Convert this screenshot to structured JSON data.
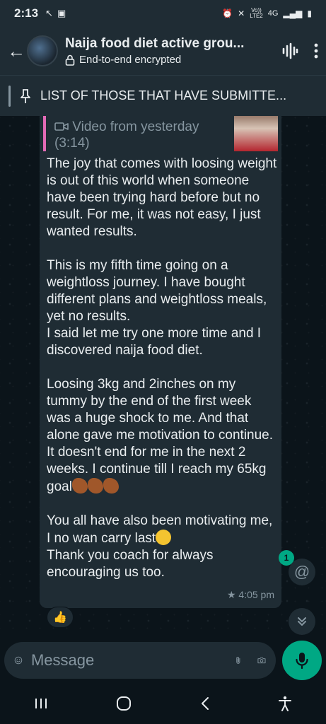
{
  "status_bar": {
    "time": "2:13",
    "net_label_top": "Vo))",
    "net_label_bottom": "LTE2",
    "signal_label": "4G"
  },
  "header": {
    "title": "Naija food diet active grou...",
    "subtitle": "End-to-end encrypted"
  },
  "pinned": {
    "text": "LIST OF THOSE THAT HAVE SUBMITTE..."
  },
  "message": {
    "quote_line1": "Video from yesterday",
    "quote_line2": "(3:14)",
    "text_part1": "The joy that comes with loosing weight is out of this world when someone have been trying hard before but no result. For me, it was not easy, I just wanted results.\n\nThis is my fifth time going on a weightloss journey. I have bought different plans and weightloss meals, yet no results.\nI said let me try one more time and I discovered naija food diet.\n\nLoosing 3kg and 2inches on my tummy by the end of the first week was a huge shock to me. And that alone gave me motivation to continue. It doesn't end for me in the next 2 weeks. I continue till I reach my 65kg goal",
    "text_part2": "\n\nYou all have also been motivating me, I no wan carry last",
    "text_part3": "\nThank you coach for always encouraging us too.",
    "time": "4:05 pm",
    "star": "★"
  },
  "reaction": {
    "emoji": "👍"
  },
  "mention": {
    "badge_count": "1",
    "symbol": "@"
  },
  "composer": {
    "placeholder": "Message"
  },
  "icons": {
    "back": "back-arrow-icon",
    "lock": "lock-icon",
    "voice": "voice-chat-icon",
    "menu": "more-options-icon",
    "pin": "pin-icon",
    "video": "video-icon",
    "emoji": "emoji-icon",
    "attach": "paperclip-icon",
    "camera": "camera-icon",
    "mic": "mic-icon"
  },
  "colors": {
    "accent": "#00a884",
    "quote_bar": "#e26ab6",
    "bubble": "#1f2c34",
    "background": "#0b141a"
  }
}
